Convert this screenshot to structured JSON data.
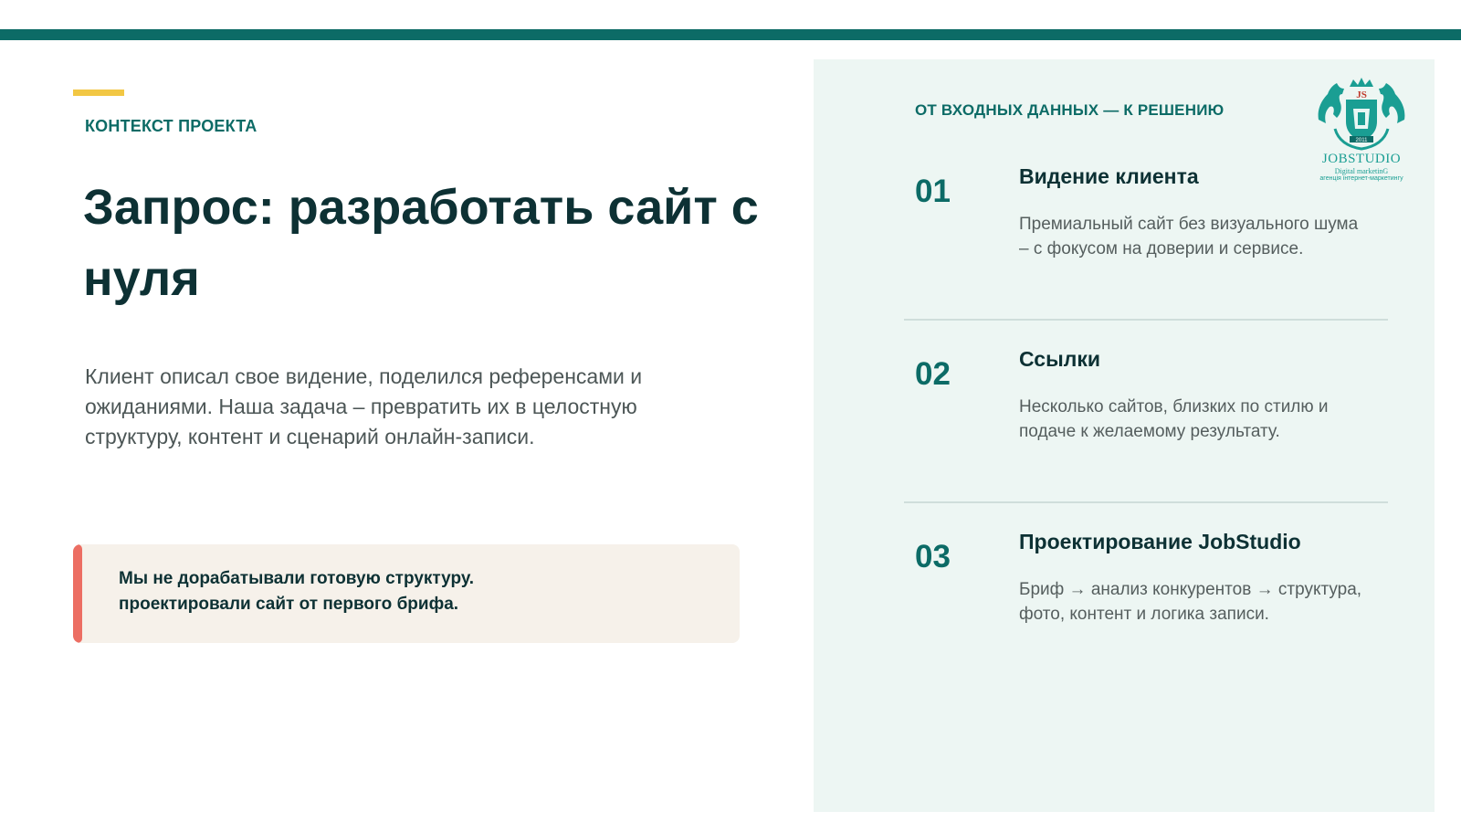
{
  "left": {
    "eyebrow": "КОНТЕКСТ ПРОЕКТА",
    "headline": "Запрос: разработать сайт с нуля",
    "lead": "Клиент описал свое видение, поделился референсами и ожиданиями. Наша задача – превратить их в целостную структуру, контент и сценарий онлайн-записи.",
    "note": {
      "line1": "Мы не дорабатывали готовую структуру.",
      "line2": "проектировали сайт от первого брифа."
    }
  },
  "panel": {
    "title": "ОТ ВХОДНЫХ ДАННЫХ — К РЕШЕНИЮ",
    "logo": {
      "monogram": "JS",
      "year": "2011",
      "brand": "JOBSTUDIO",
      "sub": "Digital marketinG",
      "sub2": "агенція інтернет-маркетингу"
    },
    "steps": [
      {
        "num": "01",
        "title": "Видение клиента",
        "desc": "Премиальный сайт без визуального шума – с фокусом на доверии и сервисе."
      },
      {
        "num": "02",
        "title": "Ссылки",
        "desc": "Несколько сайтов, близких по стилю и подаче к желаемому результату."
      },
      {
        "num": "03",
        "title": "Проектирование JobStudio",
        "desc": "Бриф → анализ конкурентов → структура, фото, контент и логика записи."
      }
    ]
  },
  "colors": {
    "brand_teal": "#0c6b66",
    "accent_yellow": "#f2c744",
    "accent_coral": "#ec6e63",
    "heading_dark": "#0d3134",
    "panel_bg": "#edf6f3",
    "note_bg": "#f6f1ea"
  }
}
